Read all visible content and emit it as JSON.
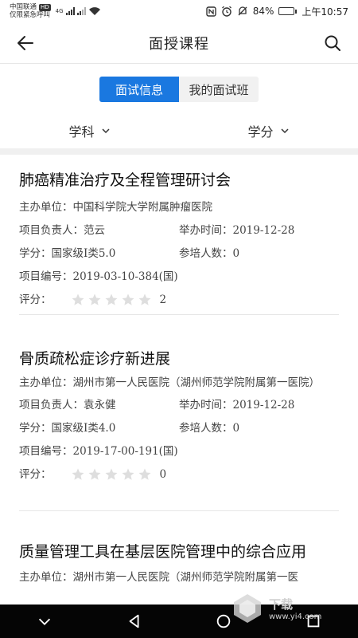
{
  "status_bar": {
    "carrier": "中国联通",
    "hd": "HD",
    "emergency": "仅限紧急呼叫",
    "network": "4G",
    "battery": "84%",
    "battery_level": 0.84,
    "time": "上午10:57"
  },
  "header": {
    "title": "面授课程"
  },
  "segment": {
    "tab_active": "面试信息",
    "tab_inactive": "我的面试班"
  },
  "filters": {
    "subject": "学科",
    "credit": "学分"
  },
  "courses": [
    {
      "title": "肺癌精准治疗及全程管理研讨会",
      "organizer": "主办单位：中国科学院大学附属肿瘤医院",
      "leader": "项目负责人：范云",
      "date": "举办时间：2019-12-28",
      "credit": "学分：国家级I类5.0",
      "participants": "参培人数：0",
      "code": "项目编号：2019-03-10-384(国)",
      "rating_label": "评分：",
      "rating_count": "2",
      "rating_stars": 0
    },
    {
      "title": "骨质疏松症诊疗新进展",
      "organizer": "主办单位：湖州市第一人民医院（湖州师范学院附属第一医院）",
      "leader": "项目负责人：袁永健",
      "date": "举办时间：2019-12-28",
      "credit": "学分：国家级I类4.0",
      "participants": "参培人数：0",
      "code": "项目编号：2019-17-00-191(国)",
      "rating_label": "评分：",
      "rating_count": "0",
      "rating_stars": 0
    },
    {
      "title": "质量管理工具在基层医院管理中的综合应用",
      "organizer": "主办单位：湖州市第一人民医院（湖州师范学院附属第一医"
    }
  ],
  "watermark": {
    "main": "下载",
    "url": "www.yi4.com"
  }
}
